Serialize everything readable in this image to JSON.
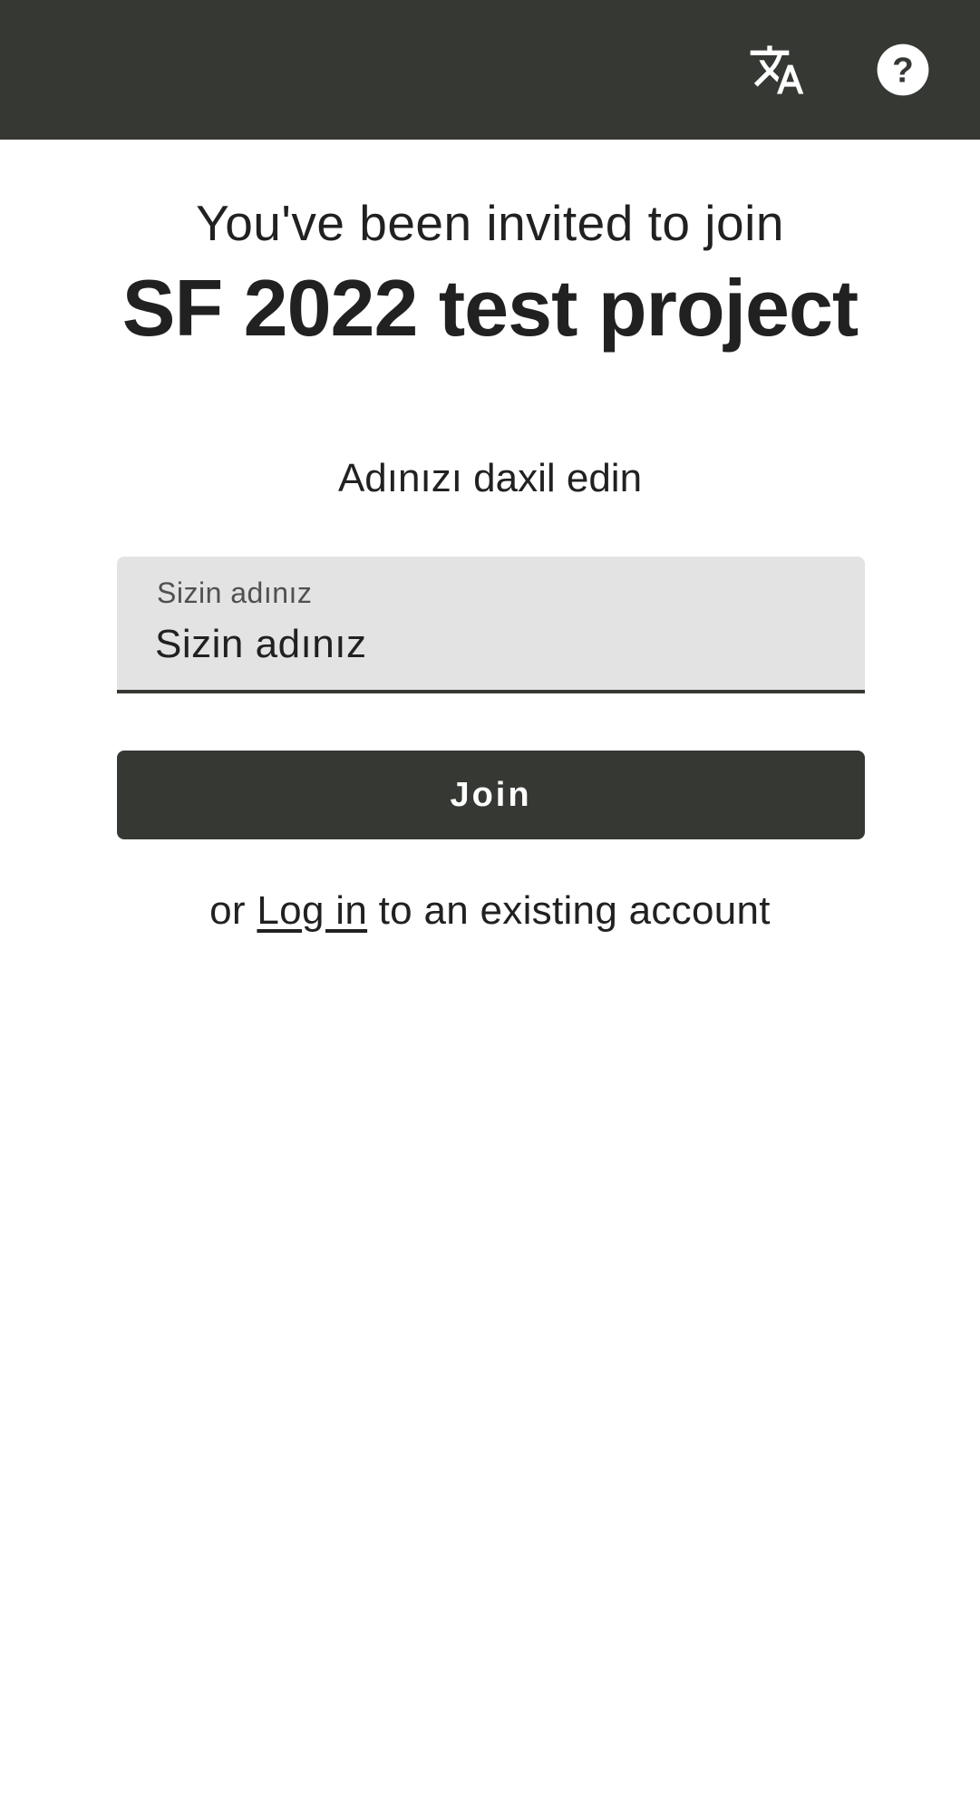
{
  "header": {
    "translate_icon": "translate-icon",
    "help_icon": "help-circle-icon",
    "background_color": "#353833"
  },
  "invite": {
    "intro": "You've been invited to join",
    "project_name": "SF 2022 test project"
  },
  "form": {
    "prompt": "Adınızı daxil edin",
    "name_field": {
      "label": "Sizin adınız",
      "placeholder": "Sizin adınız",
      "value": ""
    },
    "join_label": "Join"
  },
  "login": {
    "prefix": "or ",
    "link_text": "Log in",
    "suffix": " to an existing account"
  },
  "colors": {
    "primary": "#353833",
    "field_background": "#e3e3e3",
    "text": "#212121"
  }
}
